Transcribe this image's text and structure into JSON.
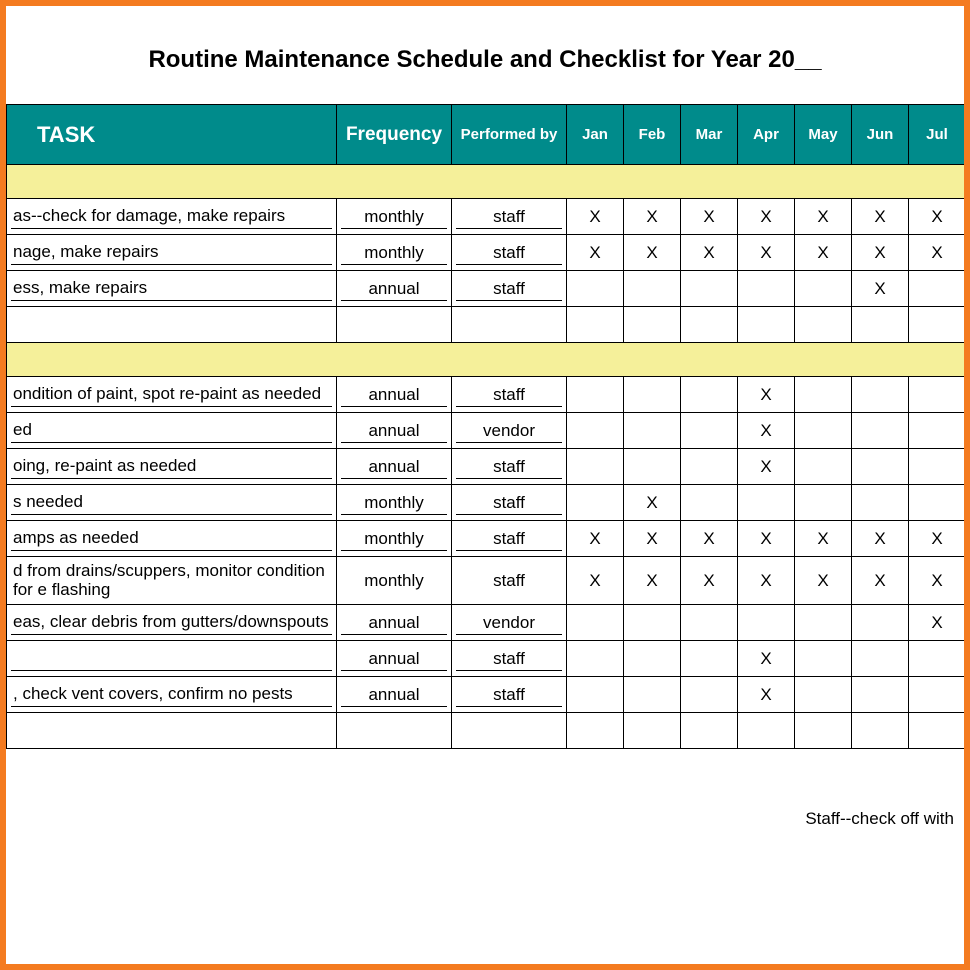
{
  "title": "Routine Maintenance Schedule and Checklist for Year 20__",
  "headers": {
    "task": "TASK",
    "frequency": "Frequency",
    "performed_by": "Performed by",
    "months": [
      "Jan",
      "Feb",
      "Mar",
      "Apr",
      "May",
      "Jun",
      "Jul",
      ""
    ]
  },
  "mark": "X",
  "sections": [
    {
      "rows": [
        {
          "task": "as--check for damage, make repairs",
          "frequency": "monthly",
          "performed_by": "staff",
          "months": [
            true,
            true,
            true,
            true,
            true,
            true,
            true,
            false
          ],
          "underline": true
        },
        {
          "task": "nage, make repairs",
          "frequency": "monthly",
          "performed_by": "staff",
          "months": [
            true,
            true,
            true,
            true,
            true,
            true,
            true,
            false
          ],
          "underline": true
        },
        {
          "task": "ess, make repairs",
          "frequency": "annual",
          "performed_by": "staff",
          "months": [
            false,
            false,
            false,
            false,
            false,
            true,
            false,
            false
          ],
          "underline": true
        },
        {
          "task": "",
          "frequency": "",
          "performed_by": "",
          "months": [
            false,
            false,
            false,
            false,
            false,
            false,
            false,
            false
          ],
          "underline": false
        }
      ]
    },
    {
      "rows": [
        {
          "task": "ondition of paint, spot re-paint as needed",
          "frequency": "annual",
          "performed_by": "staff",
          "months": [
            false,
            false,
            false,
            true,
            false,
            false,
            false,
            false
          ],
          "underline": true
        },
        {
          "task": "ed",
          "frequency": "annual",
          "performed_by": "vendor",
          "months": [
            false,
            false,
            false,
            true,
            false,
            false,
            false,
            false
          ],
          "underline": true
        },
        {
          "task": "oing, re-paint as needed",
          "frequency": "annual",
          "performed_by": "staff",
          "months": [
            false,
            false,
            false,
            true,
            false,
            false,
            false,
            false
          ],
          "underline": true
        },
        {
          "task": "s needed",
          "frequency": "monthly",
          "performed_by": "staff",
          "months": [
            false,
            true,
            false,
            false,
            false,
            false,
            false,
            false
          ],
          "underline": true
        },
        {
          "task": "amps as needed",
          "frequency": "monthly",
          "performed_by": "staff",
          "months": [
            true,
            true,
            true,
            true,
            true,
            true,
            true,
            false
          ],
          "underline": true
        },
        {
          "task": "d from drains/scuppers, monitor condition for e flashing",
          "frequency": "monthly",
          "performed_by": "staff",
          "months": [
            true,
            true,
            true,
            true,
            true,
            true,
            true,
            false
          ],
          "underline": false,
          "tall": true
        },
        {
          "task": "eas, clear debris from gutters/downspouts",
          "frequency": "annual",
          "performed_by": "vendor",
          "months": [
            false,
            false,
            false,
            false,
            false,
            false,
            true,
            false
          ],
          "underline": true
        },
        {
          "task": "",
          "frequency": "annual",
          "performed_by": "staff",
          "months": [
            false,
            false,
            false,
            true,
            false,
            false,
            false,
            false
          ],
          "underline": true
        },
        {
          "task": ", check vent covers, confirm no pests",
          "frequency": "annual",
          "performed_by": "staff",
          "months": [
            false,
            false,
            false,
            true,
            false,
            false,
            false,
            false
          ],
          "underline": true
        },
        {
          "task": "",
          "frequency": "",
          "performed_by": "",
          "months": [
            false,
            false,
            false,
            false,
            false,
            false,
            false,
            false
          ],
          "underline": false
        }
      ]
    }
  ],
  "footnote": "Staff--check off with"
}
